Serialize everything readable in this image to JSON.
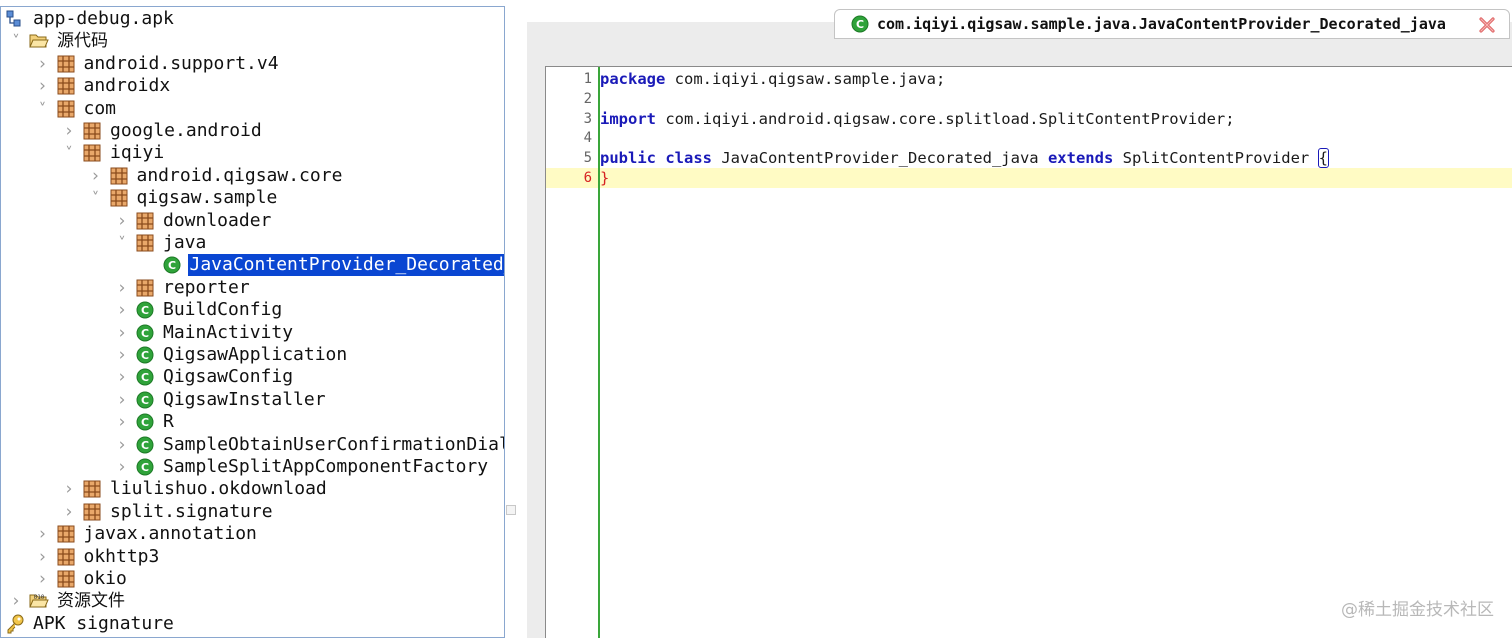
{
  "colors": {
    "selection": "#0a46d2",
    "keyword": "#1a1ab8",
    "current_line": "#fffbc4",
    "gutter": "#3aa63a"
  },
  "tree": [
    {
      "label": "app-debug.apk",
      "icon": "apk-project-icon",
      "chevron": "",
      "depth": 0
    },
    {
      "label": "源代码",
      "icon": "folder-open-icon",
      "chevron": "down",
      "depth": 0,
      "cjk": true
    },
    {
      "label": "android.support.v4",
      "icon": "package-icon",
      "chevron": "right",
      "depth": 1
    },
    {
      "label": "androidx",
      "icon": "package-icon",
      "chevron": "right",
      "depth": 1
    },
    {
      "label": "com",
      "icon": "package-icon",
      "chevron": "down",
      "depth": 1
    },
    {
      "label": "google.android",
      "icon": "package-icon",
      "chevron": "right",
      "depth": 2
    },
    {
      "label": "iqiyi",
      "icon": "package-icon",
      "chevron": "down",
      "depth": 2
    },
    {
      "label": "android.qigsaw.core",
      "icon": "package-icon",
      "chevron": "right",
      "depth": 3
    },
    {
      "label": "qigsaw.sample",
      "icon": "package-icon",
      "chevron": "down",
      "depth": 3
    },
    {
      "label": "downloader",
      "icon": "package-icon",
      "chevron": "right",
      "depth": 4
    },
    {
      "label": "java",
      "icon": "package-icon",
      "chevron": "down",
      "depth": 4
    },
    {
      "label": "JavaContentProvider_Decorated_",
      "icon": "class-icon",
      "chevron": "",
      "depth": 5,
      "selected": true
    },
    {
      "label": "reporter",
      "icon": "package-icon",
      "chevron": "right",
      "depth": 4
    },
    {
      "label": "BuildConfig",
      "icon": "class-icon",
      "chevron": "right",
      "depth": 4
    },
    {
      "label": "MainActivity",
      "icon": "class-icon",
      "chevron": "right",
      "depth": 4
    },
    {
      "label": "QigsawApplication",
      "icon": "class-icon",
      "chevron": "right",
      "depth": 4
    },
    {
      "label": "QigsawConfig",
      "icon": "class-icon",
      "chevron": "right",
      "depth": 4
    },
    {
      "label": "QigsawInstaller",
      "icon": "class-icon",
      "chevron": "right",
      "depth": 4
    },
    {
      "label": "R",
      "icon": "class-icon",
      "chevron": "right",
      "depth": 4
    },
    {
      "label": "SampleObtainUserConfirmationDialo",
      "icon": "class-icon",
      "chevron": "right",
      "depth": 4
    },
    {
      "label": "SampleSplitAppComponentFactory",
      "icon": "class-icon",
      "chevron": "right",
      "depth": 4
    },
    {
      "label": "liulishuo.okdownload",
      "icon": "package-icon",
      "chevron": "right",
      "depth": 2
    },
    {
      "label": "split.signature",
      "icon": "package-icon",
      "chevron": "right",
      "depth": 2
    },
    {
      "label": "javax.annotation",
      "icon": "package-icon",
      "chevron": "right",
      "depth": 1
    },
    {
      "label": "okhttp3",
      "icon": "package-icon",
      "chevron": "right",
      "depth": 1
    },
    {
      "label": "okio",
      "icon": "package-icon",
      "chevron": "right",
      "depth": 1
    },
    {
      "label": "资源文件",
      "icon": "resources-folder-icon",
      "chevron": "right",
      "depth": 0,
      "cjk": true
    },
    {
      "label": "APK signature",
      "icon": "key-icon",
      "chevron": "",
      "depth": 0
    }
  ],
  "tab": {
    "title": "com.iqiyi.qigsaw.sample.java.JavaContentProvider_Decorated_java"
  },
  "code": {
    "lines": [
      {
        "num": "1",
        "parts": [
          {
            "t": "package",
            "kw": true
          },
          {
            "t": " com.iqiyi.qigsaw.sample.java;"
          }
        ]
      },
      {
        "num": "2",
        "parts": []
      },
      {
        "num": "3",
        "parts": [
          {
            "t": "import",
            "kw": true
          },
          {
            "t": " com.iqiyi.android.qigsaw.core.splitload.SplitContentProvider;"
          }
        ]
      },
      {
        "num": "4",
        "parts": []
      },
      {
        "num": "5",
        "parts": [
          {
            "t": "public",
            "kw": true
          },
          {
            "t": " "
          },
          {
            "t": "class",
            "kw": true
          },
          {
            "t": " JavaContentProvider_Decorated_java "
          },
          {
            "t": "extends",
            "kw": true
          },
          {
            "t": " SplitContentProvider "
          },
          {
            "t": "{",
            "hl": true
          }
        ]
      },
      {
        "num": "6",
        "current": true,
        "parts": [
          {
            "t": "}",
            "red": true
          }
        ]
      }
    ]
  },
  "watermark": "@稀土掘金技术社区"
}
